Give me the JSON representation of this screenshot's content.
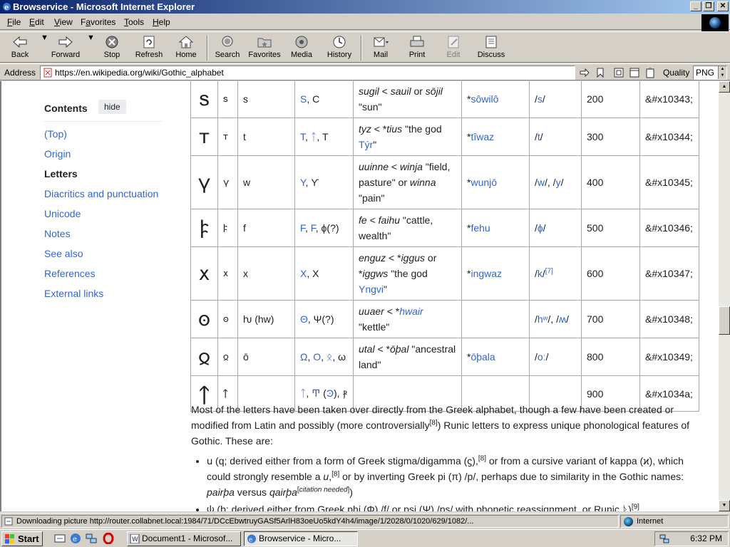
{
  "window": {
    "title": "Browservice - Microsoft Internet Explorer"
  },
  "menu": [
    {
      "label": "File",
      "key": "F"
    },
    {
      "label": "Edit",
      "key": "E"
    },
    {
      "label": "View",
      "key": "V"
    },
    {
      "label": "Favorites",
      "key": "a"
    },
    {
      "label": "Tools",
      "key": "T"
    },
    {
      "label": "Help",
      "key": "H"
    }
  ],
  "toolbar": {
    "back": "Back",
    "forward": "Forward",
    "stop": "Stop",
    "refresh": "Refresh",
    "home": "Home",
    "search": "Search",
    "favorites": "Favorites",
    "media": "Media",
    "history": "History",
    "mail": "Mail",
    "print": "Print",
    "edit": "Edit",
    "discuss": "Discuss"
  },
  "address": {
    "label": "Address",
    "url": "https://en.wikipedia.org/wiki/Gothic_alphabet",
    "quality_label": "Quality",
    "quality_value": "PNG"
  },
  "toc": {
    "title": "Contents",
    "hide": "hide",
    "items": [
      "(Top)",
      "Origin",
      "Letters",
      "Diacritics and punctuation",
      "Unicode",
      "Notes",
      "See also",
      "References",
      "External links"
    ],
    "active_index": 2
  },
  "table": {
    "rows": [
      {
        "glyph": "𐍃",
        "small": "𐍃",
        "translit": "s",
        "source": [
          {
            "t": "S",
            "l": true
          },
          {
            "t": ", ",
            "l": false
          },
          {
            "t": "Ϲ",
            "l": false
          }
        ],
        "name_html": "<i>sugil</i> &lt; <i>sauil</i> or <i>sōjil</i> \"sun\"",
        "pg": "*<a>sôwilô</a>",
        "ipa": "/<a>s</a>/",
        "value": "200",
        "unicode": "&#x10343;"
      },
      {
        "glyph": "𐍄",
        "small": "𐍄",
        "translit": "t",
        "source": [
          {
            "t": "T",
            "l": true
          },
          {
            "t": ", ",
            "l": false
          },
          {
            "t": "ᛏ",
            "l": true
          },
          {
            "t": ", Т",
            "l": false
          }
        ],
        "name_html": "<i>tyz</i> &lt; *<i>tius</i> \"the god <a>Týr</a>\"",
        "pg": "*<a>tîwaz</a>",
        "ipa": "/<a>t</a>/",
        "value": "300",
        "unicode": "&#x10344;"
      },
      {
        "glyph": "𐍅",
        "small": "𐍅",
        "translit": "w",
        "source": [
          {
            "t": "Y",
            "l": true
          },
          {
            "t": ", ϒ",
            "l": false
          }
        ],
        "name_html": "<i>uuinne</i> &lt; <i>winja</i> \"field, pasture\" or <i>winna</i> \"pain\"",
        "pg": "*<a>wunjō</a>",
        "ipa": "/<a>w</a>/, /<a>y</a>/",
        "value": "400",
        "unicode": "&#x10345;"
      },
      {
        "glyph": "𐍆",
        "small": "𐍆",
        "translit": "f",
        "source": [
          {
            "t": "F",
            "l": true
          },
          {
            "t": ", ",
            "l": false
          },
          {
            "t": "F",
            "l": true
          },
          {
            "t": ", ϕ(?)",
            "l": false
          }
        ],
        "name_html": "<i>fe</i> &lt; <i>faihu</i> \"cattle, wealth\"",
        "pg": "*<a>fehu</a>",
        "ipa": "/<a>ɸ</a>/",
        "value": "500",
        "unicode": "&#x10346;"
      },
      {
        "glyph": "𐍇",
        "small": "𐍇",
        "translit": "x",
        "source": [
          {
            "t": "X",
            "l": true
          },
          {
            "t": ", Χ",
            "l": false
          }
        ],
        "name_html": "<i>enguz</i> &lt; *<i>iggus</i> or *<i>iggws</i> \"the god <a>Yngvi</a>\"",
        "pg": "*<a>ingwaz</a>",
        "ipa": "/<a>k</a>/<sup><a>[7]</a></sup>",
        "value": "600",
        "unicode": "&#x10347;"
      },
      {
        "glyph": "𐍈",
        "small": "𐍈",
        "translit": "ƕ (hw)",
        "source": [
          {
            "t": "Θ",
            "l": true
          },
          {
            "t": ", Ψ(?)",
            "l": false
          }
        ],
        "name_html": "<i>uuaer</i> &lt; *<i><a>hwair</a></i> \"kettle\"",
        "pg": "",
        "ipa": "/<a>hʷ</a>/, /<a>ʍ</a>/",
        "value": "700",
        "unicode": "&#x10348;"
      },
      {
        "glyph": "𐍉",
        "small": "𐍉",
        "translit": "ō",
        "source": [
          {
            "t": "Ω",
            "l": true
          },
          {
            "t": ", ",
            "l": false
          },
          {
            "t": "O",
            "l": true
          },
          {
            "t": ", ",
            "l": false
          },
          {
            "t": "ᛟ",
            "l": true
          },
          {
            "t": ", ω",
            "l": false
          }
        ],
        "name_html": "<i>utal</i> &lt; *<i>ōþal</i> \"ancestral land\"",
        "pg": "*<a>ōþala</a>",
        "ipa": "/<a>oː</a>/",
        "value": "800",
        "unicode": "&#x10349;"
      },
      {
        "glyph": "𐍊",
        "small": "𐍊",
        "translit": "",
        "source": [
          {
            "t": "ᛏ",
            "l": true
          },
          {
            "t": ", ",
            "l": false
          },
          {
            "t": "Ͳ",
            "l": true
          },
          {
            "t": " (",
            "l": false
          },
          {
            "t": "Ͽ",
            "l": true
          },
          {
            "t": "), ⳁ",
            "l": false
          }
        ],
        "name_html": "",
        "pg": "",
        "ipa": "",
        "value": "900",
        "unicode": "&#x1034a;"
      }
    ]
  },
  "prose": {
    "para_html": "Most of the letters have been taken over directly from the <a>Greek alphabet</a>, though a few have been created or modified from <a>Latin</a> and possibly (more controversially<sup><a>[8]</a></sup>) <a>Runic letters</a> to express unique phonological features of Gothic. These are:",
    "bullets_html": [
      "𐌵 (q; derived either from a form of Greek <a>stigma</a>/<a>digamma</a> (ϛ),<sup><a>[8]</a></sup> or from a cursive variant of <a>kappa (ϰ)</a>, which could strongly resemble a <i><a>u</a></i>,<sup><a>[8]</a></sup> or by inverting Greek <a>pi (π)</a> /p/, perhaps due to similarity in the Gothic names: <i>pairþa</i> versus <i>qairþa</i><sup>[<i><a>citation needed</a></i>]</sup>)",
      "𐌸 (þ; derived either from Greek <a>phi (Φ)</a> /f/ or <a>psi (Ψ)</a> /ps/ with phonetic reassignment, or Runic <a>ᚦ</a>)<sup><a>[9]</a></sup>"
    ]
  },
  "status": {
    "text": "Downloading picture http://router.collabnet.local:1984/71/DCcEbwtruyGASf5ArlH83oeUo5kdY4h4/image/1/2028/0/1020/629/1082/...",
    "zone": "Internet"
  },
  "taskbar": {
    "start": "Start",
    "tasks": [
      "Document1 - Microsof...",
      "Browservice - Micro..."
    ],
    "clock": "6:32 PM"
  }
}
